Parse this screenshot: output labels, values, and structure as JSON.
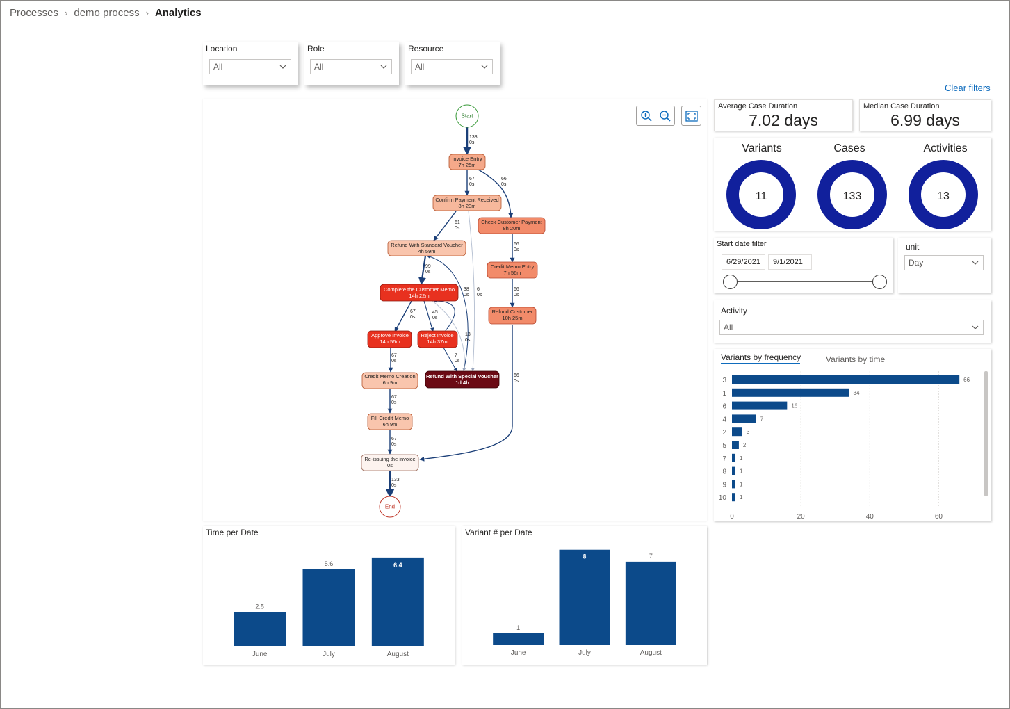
{
  "breadcrumb": {
    "items": [
      "Processes",
      "demo process"
    ],
    "current": "Analytics"
  },
  "filters": [
    {
      "label": "Location",
      "value": "All"
    },
    {
      "label": "Role",
      "value": "All"
    },
    {
      "label": "Resource",
      "value": "All"
    }
  ],
  "clear_filters": "Clear filters",
  "kpis": {
    "avg_label": "Average Case Duration",
    "avg_value": "7.02 days",
    "median_label": "Median Case Duration",
    "median_value": "6.99 days"
  },
  "donuts": [
    {
      "title": "Variants",
      "value": "11"
    },
    {
      "title": "Cases",
      "value": "133"
    },
    {
      "title": "Activities",
      "value": "13"
    }
  ],
  "date_filter": {
    "label": "Start date filter",
    "start": "6/29/2021",
    "end": "9/1/2021"
  },
  "unit": {
    "label": "unit",
    "value": "Day"
  },
  "activity": {
    "label": "Activity",
    "value": "All"
  },
  "variants_tabs": {
    "active": "Variants by frequency",
    "inactive": "Variants by time"
  },
  "process_map": {
    "start": "Start",
    "end": "End",
    "nodes": [
      {
        "id": "invoice-entry",
        "name": "Invoice Entry",
        "time": "7h 25m"
      },
      {
        "id": "confirm-payment",
        "name": "Confirm Payment Received",
        "time": "8h 23m"
      },
      {
        "id": "check-customer-payment",
        "name": "Check Customer Payment",
        "time": "8h 20m"
      },
      {
        "id": "refund-standard",
        "name": "Refund With Standard Voucher",
        "time": "4h 59m"
      },
      {
        "id": "credit-memo-entry",
        "name": "Credit Memo Entry",
        "time": "7h 56m"
      },
      {
        "id": "complete-memo",
        "name": "Complete the Customer Memo",
        "time": "14h 22m"
      },
      {
        "id": "refund-customer",
        "name": "Refund Customer",
        "time": "10h 25m"
      },
      {
        "id": "approve-invoice",
        "name": "Approve Invoice",
        "time": "14h 56m"
      },
      {
        "id": "reject-invoice",
        "name": "Reject Invoice",
        "time": "14h 37m"
      },
      {
        "id": "credit-memo-creation",
        "name": "Credit Memo Creation",
        "time": "6h 9m"
      },
      {
        "id": "refund-special",
        "name": "Refund With Special Voucher",
        "time": "1d 4h"
      },
      {
        "id": "fill-credit-memo",
        "name": "Fill Credit Memo",
        "time": "6h 9m"
      },
      {
        "id": "reissuing",
        "name": "Re-issuing the invoice",
        "time": "0s"
      }
    ],
    "edges": [
      {
        "count": "133",
        "time": "0s"
      },
      {
        "count": "67",
        "time": "0s"
      },
      {
        "count": "66",
        "time": "0s"
      },
      {
        "count": "61",
        "time": "0s"
      },
      {
        "count": "66",
        "time": "0s"
      },
      {
        "count": "99",
        "time": "0s"
      },
      {
        "count": "38",
        "time": "0s"
      },
      {
        "count": "6",
        "time": "0s"
      },
      {
        "count": "66",
        "time": "0s"
      },
      {
        "count": "67",
        "time": "0s"
      },
      {
        "count": "45",
        "time": "0s"
      },
      {
        "count": "13",
        "time": "0s"
      },
      {
        "count": "67",
        "time": "0s"
      },
      {
        "count": "7",
        "time": "0s"
      },
      {
        "count": "66",
        "time": "0s"
      },
      {
        "count": "67",
        "time": "0s"
      },
      {
        "count": "67",
        "time": "0s"
      },
      {
        "count": "133",
        "time": "0s"
      }
    ]
  },
  "chart_data": [
    {
      "id": "variants",
      "type": "bar",
      "orientation": "horizontal",
      "categories": [
        "3",
        "1",
        "6",
        "4",
        "2",
        "5",
        "7",
        "8",
        "9",
        "10"
      ],
      "values": [
        66,
        34,
        16,
        7,
        3,
        2,
        1,
        1,
        1,
        1
      ],
      "xlim": [
        0,
        70
      ],
      "xticks": [
        0,
        20,
        40,
        60
      ],
      "grid": true,
      "color": "#0c4a8a"
    },
    {
      "id": "time-per-date",
      "type": "bar",
      "title": "Time per Date",
      "categories": [
        "June",
        "July",
        "August"
      ],
      "values": [
        2.5,
        5.6,
        6.4
      ],
      "ylim": [
        0,
        7.2
      ],
      "color": "#0c4a8a"
    },
    {
      "id": "variant-per-date",
      "type": "bar",
      "title": "Variant # per Date",
      "categories": [
        "June",
        "July",
        "August"
      ],
      "values": [
        1,
        8,
        7
      ],
      "ylim": [
        0,
        8.8
      ],
      "color": "#0c4a8a"
    }
  ],
  "colors": {
    "accent": "#0f6cbd",
    "bar": "#0c4a8a",
    "donut": "#11209c"
  }
}
